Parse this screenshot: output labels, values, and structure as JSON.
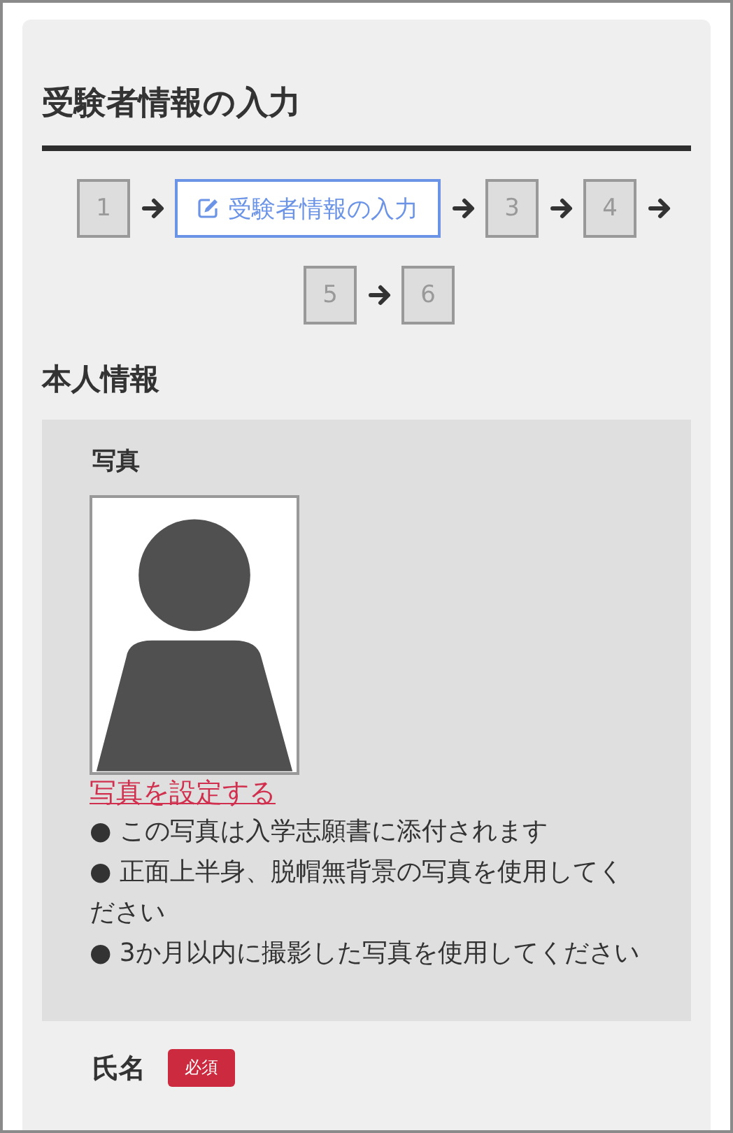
{
  "title": "受験者情報の入力",
  "steps": [
    {
      "label": "1",
      "selected": false
    },
    {
      "label": "受験者情報の入力",
      "selected": true
    },
    {
      "label": "3",
      "selected": false
    },
    {
      "label": "4",
      "selected": false
    },
    {
      "label": "5",
      "selected": false
    },
    {
      "label": "6",
      "selected": false
    }
  ],
  "section_title": "本人情報",
  "photo": {
    "label": "写真",
    "link": "写真を設定する",
    "notes": [
      "● この写真は入学志願書に添付されます",
      "● 正面上半身、脱帽無背景の写真を使用してください",
      "● 3か月以内に撮影した写真を使用してください"
    ]
  },
  "name_field": {
    "label": "氏名",
    "required_badge": "必須"
  }
}
